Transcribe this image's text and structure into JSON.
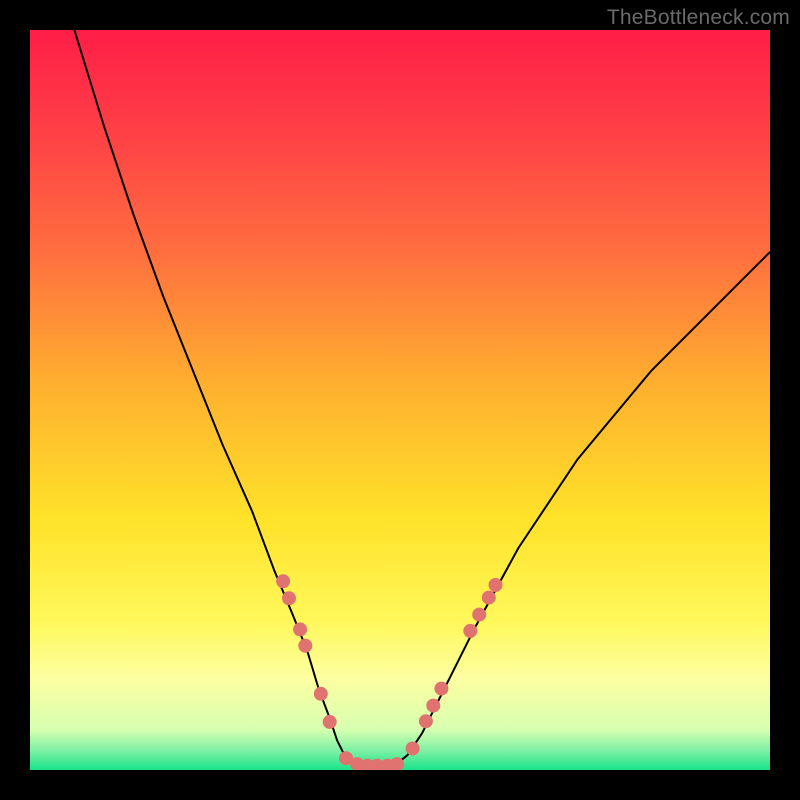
{
  "watermark": "TheBottleneck.com",
  "chart_data": {
    "type": "line",
    "title": "",
    "xlabel": "",
    "ylabel": "",
    "xlim": [
      0,
      100
    ],
    "ylim": [
      0,
      100
    ],
    "grid": false,
    "legend": false,
    "background_gradient_stops": [
      {
        "offset": 0.0,
        "color": "#ff1e46"
      },
      {
        "offset": 0.12,
        "color": "#ff3b47"
      },
      {
        "offset": 0.3,
        "color": "#ff6e3f"
      },
      {
        "offset": 0.48,
        "color": "#ffb02f"
      },
      {
        "offset": 0.66,
        "color": "#ffe229"
      },
      {
        "offset": 0.8,
        "color": "#fff85b"
      },
      {
        "offset": 0.875,
        "color": "#fdffa0"
      },
      {
        "offset": 0.945,
        "color": "#d7ffb0"
      },
      {
        "offset": 0.975,
        "color": "#7af0a4"
      },
      {
        "offset": 1.0,
        "color": "#18e28a"
      }
    ],
    "series": [
      {
        "name": "bottleneck-curve",
        "color": "#000000",
        "width": 2,
        "x": [
          6,
          10,
          14,
          18,
          22,
          26,
          30,
          33,
          35.5,
          37.5,
          39,
          40.5,
          41.5,
          42.5,
          43.8,
          46.5,
          49.5,
          51,
          53,
          56,
          60,
          66,
          74,
          84,
          96,
          100
        ],
        "y": [
          100,
          87,
          75,
          64,
          54,
          44,
          35,
          27,
          21,
          16,
          11,
          7,
          4,
          2,
          0.8,
          0.5,
          0.8,
          2,
          5,
          11,
          19,
          30,
          42,
          54,
          66,
          70
        ]
      }
    ],
    "markers": {
      "name": "highlight-dots",
      "color": "#e0736f",
      "radius": 7,
      "points": [
        {
          "x": 34.2,
          "y": 25.5
        },
        {
          "x": 35.0,
          "y": 23.2
        },
        {
          "x": 36.5,
          "y": 19.0
        },
        {
          "x": 37.2,
          "y": 16.8
        },
        {
          "x": 39.3,
          "y": 10.3
        },
        {
          "x": 40.5,
          "y": 6.5
        },
        {
          "x": 42.7,
          "y": 1.6
        },
        {
          "x": 44.2,
          "y": 0.8
        },
        {
          "x": 45.6,
          "y": 0.6
        },
        {
          "x": 46.9,
          "y": 0.6
        },
        {
          "x": 48.3,
          "y": 0.6
        },
        {
          "x": 49.6,
          "y": 0.8
        },
        {
          "x": 51.7,
          "y": 2.9
        },
        {
          "x": 53.5,
          "y": 6.6
        },
        {
          "x": 54.5,
          "y": 8.7
        },
        {
          "x": 55.6,
          "y": 11.0
        },
        {
          "x": 59.5,
          "y": 18.8
        },
        {
          "x": 60.7,
          "y": 21.0
        },
        {
          "x": 62.0,
          "y": 23.3
        },
        {
          "x": 62.9,
          "y": 25.0
        }
      ]
    }
  }
}
